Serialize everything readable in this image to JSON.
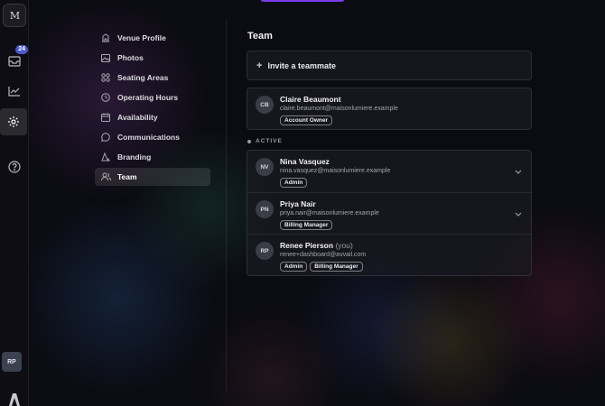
{
  "rail": {
    "logo_text": "M",
    "notification_count": "24",
    "user_initials": "RP",
    "icons": [
      "logo-icon",
      "inbox-icon",
      "chart-icon",
      "settings-icon",
      "help-icon",
      "brand-icon"
    ]
  },
  "nav": {
    "items": [
      {
        "label": "Venue Profile",
        "icon": "building-icon"
      },
      {
        "label": "Photos",
        "icon": "image-icon"
      },
      {
        "label": "Seating Areas",
        "icon": "grid-icon"
      },
      {
        "label": "Operating Hours",
        "icon": "clock-icon"
      },
      {
        "label": "Availability",
        "icon": "calendar-icon"
      },
      {
        "label": "Communications",
        "icon": "chat-icon"
      },
      {
        "label": "Branding",
        "icon": "palette-icon"
      },
      {
        "label": "Team",
        "icon": "users-icon",
        "active": true
      }
    ]
  },
  "main": {
    "title": "Team",
    "invite_label": "Invite a teammate",
    "owner": {
      "initials": "CB",
      "name": "Claire Beaumont",
      "email": "claire.beaumont@maisonlumiere.example",
      "roles": [
        "Account Owner"
      ]
    },
    "active_label": "ACTIVE",
    "members": [
      {
        "initials": "NV",
        "name": "Nina Vasquez",
        "email": "nina.vasquez@maisonlumiere.example",
        "roles": [
          "Admin"
        ],
        "expandable": true
      },
      {
        "initials": "PN",
        "name": "Priya Nair",
        "email": "priya.nair@maisonlumiere.example",
        "roles": [
          "Billing Manager"
        ],
        "expandable": true
      },
      {
        "initials": "RP",
        "name": "Renee Pierson",
        "you_label": "(you)",
        "email": "renee+dashboard@avvail.com",
        "roles": [
          "Admin",
          "Billing Manager"
        ],
        "expandable": false
      }
    ]
  },
  "colors": {
    "accent": "#7c3aed",
    "badge": "#4a58c8",
    "background": "#0b0b12"
  }
}
